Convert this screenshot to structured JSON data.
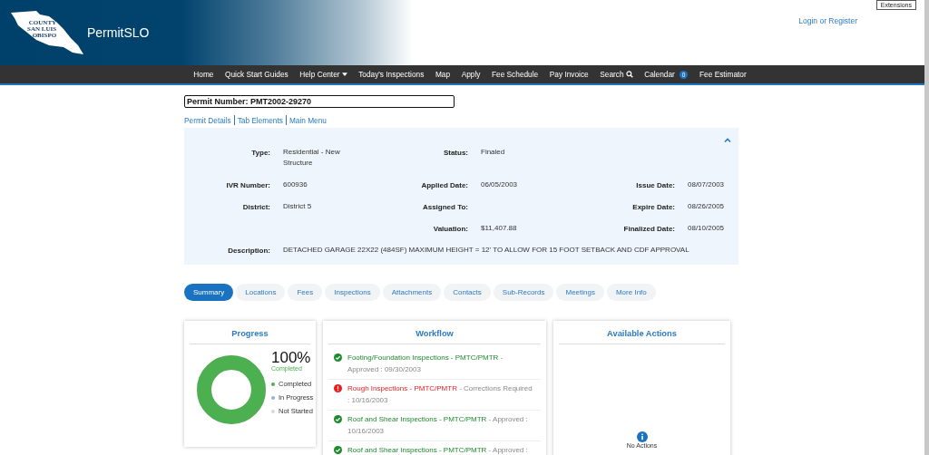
{
  "header": {
    "logo_text": [
      "COUNTY",
      "SAN LUIS",
      "OBISPO"
    ],
    "title": "PermitSLO",
    "tooltip": "Extensions",
    "login_link": "Login or Register"
  },
  "nav": [
    {
      "label": "Home",
      "kind": "link"
    },
    {
      "label": "Quick Start Guides",
      "kind": "link"
    },
    {
      "label": "Help Center",
      "kind": "dropdown"
    },
    {
      "label": "Today's Inspections",
      "kind": "link"
    },
    {
      "label": "Map",
      "kind": "link"
    },
    {
      "label": "Apply",
      "kind": "link"
    },
    {
      "label": "Fee Schedule",
      "kind": "link"
    },
    {
      "label": "Pay Invoice",
      "kind": "link"
    },
    {
      "label": "Search",
      "kind": "search"
    },
    {
      "label": "Calendar",
      "kind": "badge",
      "badge": "0"
    },
    {
      "label": "Fee Estimator",
      "kind": "link"
    }
  ],
  "permit_number": "Permit Number: PMT2002-29270",
  "breadcrumbs": [
    "Permit Details",
    "Tab Elements",
    "Main Menu"
  ],
  "details": {
    "expanded": true,
    "rows": [
      [
        {
          "label": "Type:",
          "value": "Residential - New Structure"
        },
        {
          "label": "Status:",
          "value": "Finaled"
        },
        null
      ],
      [
        {
          "label": "IVR Number:",
          "value": "600936"
        },
        {
          "label": "Applied Date:",
          "value": "06/05/2003"
        },
        {
          "label": "Issue Date:",
          "value": "08/07/2003"
        }
      ],
      [
        {
          "label": "District:",
          "value": "District 5"
        },
        {
          "label": "Assigned To:"
        },
        {
          "label": "Expire Date:",
          "value": "08/26/2005"
        }
      ],
      [
        null,
        {
          "label": "Valuation:",
          "value": "$11,407.88"
        },
        {
          "label": "Finalized Date:",
          "value": "08/10/2005"
        }
      ]
    ],
    "description": {
      "label": "Description:",
      "value": "DETACHED GARAGE 22X22 (484SF) MAXIMUM HEIGHT = 12' TO ALLOW FOR 15 FOOT SETBACK AND CDF APPROVAL"
    }
  },
  "tabs": [
    {
      "label": "Summary",
      "selected": true
    },
    {
      "label": "Locations",
      "selected": false
    },
    {
      "label": "Fees",
      "selected": false
    },
    {
      "label": "Inspections",
      "selected": false
    },
    {
      "label": "Attachments",
      "selected": false
    },
    {
      "label": "Contacts",
      "selected": false
    },
    {
      "label": "Sub-Records",
      "selected": false
    },
    {
      "label": "Meetings",
      "selected": false
    },
    {
      "label": "More Info",
      "selected": false
    }
  ],
  "progress": {
    "title": "Progress",
    "percent": "100%",
    "percent_label": "Completed",
    "level": 1,
    "legend": [
      {
        "label": "Completed",
        "color": "#4caf50"
      },
      {
        "label": "In Progress",
        "color": "#90b4d0"
      },
      {
        "label": "Not Started",
        "color": "#d8d8d8"
      }
    ]
  },
  "workflow": {
    "title": "Workflow",
    "items": [
      {
        "name": "Footing/Foundation Inspections - PMTC/PMTR",
        "kind": "approved",
        "detail": " - Approved : 09/30/2003"
      },
      {
        "name": "Rough Inspections - PMTC/PMTR",
        "kind": "corrections",
        "detail": " - Corrections Required : 10/16/2003"
      },
      {
        "name": "Roof and Shear Inspections - PMTC/PMTR",
        "kind": "approved",
        "detail": " - Approved : 10/16/2003"
      },
      {
        "name": "Roof and Shear Inspections - PMTC/PMTR",
        "kind": "approved",
        "detail": " - Approved :"
      }
    ]
  },
  "actions": {
    "title": "Available Actions",
    "empty_text": "No Actions"
  }
}
